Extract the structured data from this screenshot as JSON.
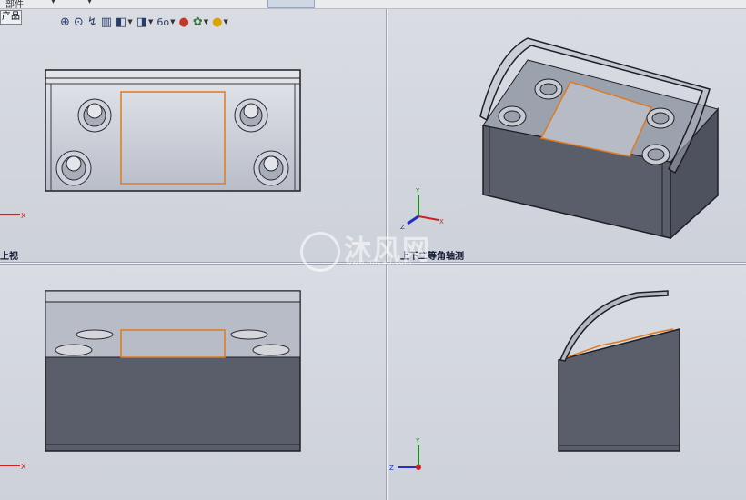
{
  "topbar": {
    "menu_item": "部件"
  },
  "part_tab": {
    "label": "产品"
  },
  "views": {
    "top_left_label": "上视",
    "top_right_label": "上下二等角轴测"
  },
  "triad": {
    "x": "X",
    "y": "Y",
    "z": "Z"
  },
  "watermark": {
    "text": "沐风网",
    "url": "www.mfcad.com"
  },
  "hud_icons": [
    "zoom-to-fit-icon",
    "zoom-area-icon",
    "previous-view-icon",
    "section-view-icon",
    "view-orientation-icon",
    "display-style-icon",
    "hide-show-icon",
    "edit-appearance-icon",
    "apply-scene-icon",
    "view-settings-icon"
  ],
  "colors": {
    "body": "#5a5e6b",
    "edge": "#1d1f25",
    "accent": "#e07a1f",
    "viewport": "#d5d8df"
  }
}
